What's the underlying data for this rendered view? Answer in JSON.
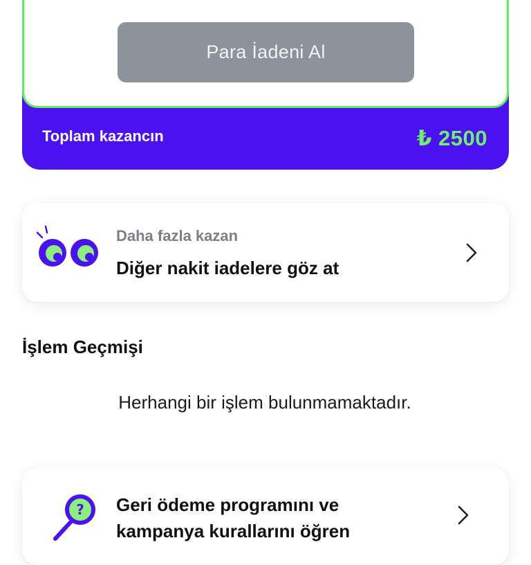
{
  "earnings_card": {
    "refund_button_label": "Para İadeni Al",
    "total_label": "Toplam kazancın",
    "total_amount": "₺ 2500"
  },
  "browse_card": {
    "subtitle": "Daha fazla kazan",
    "title": "Diğer nakit iadelere göz at",
    "icon": "eyes-icon"
  },
  "history": {
    "title": "İşlem Geçmişi",
    "empty_message": "Herhangi bir işlem bulunmamaktadır."
  },
  "rules_card": {
    "title_line1": "Geri ödeme programını ve",
    "title_line2": "kampanya kurallarını öğren",
    "icon": "magnifier-question-icon"
  },
  "colors": {
    "brand_purple": "#4a12f0",
    "accent_green": "#5cf05a",
    "button_gray": "#8c939b"
  }
}
